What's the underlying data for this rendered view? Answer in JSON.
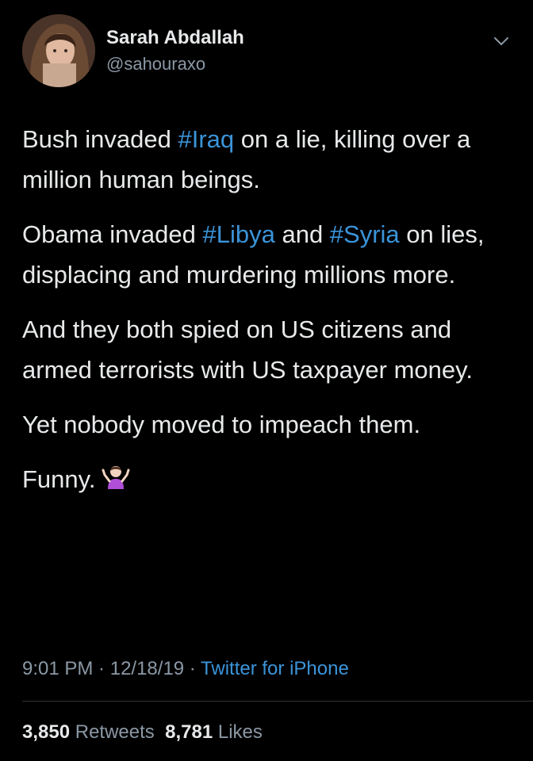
{
  "author": {
    "name": "Sarah Abdallah",
    "handle": "@sahouraxo"
  },
  "tweet": {
    "p1": {
      "a": "Bush invaded ",
      "tag1": "#Iraq",
      "b": " on a lie, killing over a million human beings."
    },
    "p2": {
      "a": "Obama invaded ",
      "tag1": "#Libya",
      "b": " and ",
      "tag2": "#Syria",
      "c": " on lies, displacing and murdering millions more."
    },
    "p3": "And they both spied on US citizens and armed terrorists with US taxpayer money.",
    "p4": "Yet nobody moved to impeach them.",
    "p5": "Funny.",
    "p5_emoji": "person-shrugging-icon"
  },
  "meta": {
    "time": "9:01 PM",
    "sep1": " · ",
    "date": "12/18/19",
    "sep2": " · ",
    "source": "Twitter for iPhone"
  },
  "stats": {
    "retweets_count": "3,850",
    "retweets_label": "Retweets",
    "likes_count": "8,781",
    "likes_label": "Likes"
  },
  "colors": {
    "background": "#000000",
    "text": "#e7e9ea",
    "secondary": "#8b98a5",
    "link": "#3b94d9"
  }
}
